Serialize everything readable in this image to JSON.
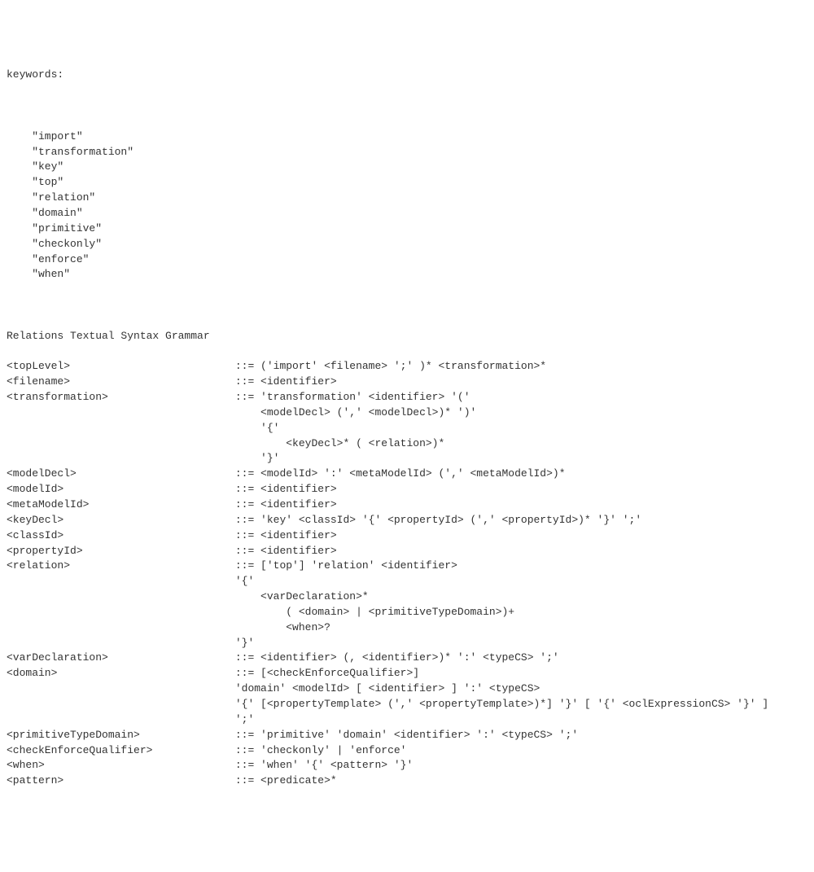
{
  "keywords_header": "keywords:",
  "keywords": [
    "\"import\"",
    "\"transformation\"",
    "\"key\"",
    "\"top\"",
    "\"relation\"",
    "\"domain\"",
    "\"primitive\"",
    "\"checkonly\"",
    "\"enforce\"",
    "\"when\""
  ],
  "grammar_header": "Relations Textual Syntax Grammar",
  "rules": [
    {
      "lhs": "<topLevel>",
      "rhs": [
        "::= ('import' <filename> ';' )* <transformation>*"
      ]
    },
    {
      "lhs": "<filename>",
      "rhs": [
        "::= <identifier>"
      ]
    },
    {
      "lhs": "<transformation>",
      "rhs": [
        "::= 'transformation' <identifier> '('",
        "    <modelDecl> (',' <modelDecl>)* ')'",
        "    '{'",
        "        <keyDecl>* ( <relation>)*",
        "    '}'"
      ]
    },
    {
      "lhs": "<modelDecl>",
      "rhs": [
        "::= <modelId> ':' <metaModelId> (',' <metaModelId>)*"
      ]
    },
    {
      "lhs": "<modelId>",
      "rhs": [
        "::= <identifier>"
      ]
    },
    {
      "lhs": "<metaModelId>",
      "rhs": [
        "::= <identifier>"
      ]
    },
    {
      "lhs": "<keyDecl>",
      "rhs": [
        "::= 'key' <classId> '{' <propertyId> (',' <propertyId>)* '}' ';'"
      ]
    },
    {
      "lhs": "<classId>",
      "rhs": [
        "::= <identifier>"
      ]
    },
    {
      "lhs": "<propertyId>",
      "rhs": [
        "::= <identifier>"
      ]
    },
    {
      "lhs": "<relation>",
      "rhs": [
        "::= ['top'] 'relation' <identifier>",
        "'{'",
        "    <varDeclaration>*",
        "        ( <domain> | <primitiveTypeDomain>)+",
        "        <when>?",
        "'}'"
      ]
    },
    {
      "lhs": "<varDeclaration>",
      "rhs": [
        "::= <identifier> (, <identifier>)* ':' <typeCS> ';'"
      ]
    },
    {
      "lhs": "<domain>",
      "rhs": [
        "::= [<checkEnforceQualifier>]",
        "'domain' <modelId> [ <identifier> ] ':' <typeCS>",
        "'{' [<propertyTemplate> (',' <propertyTemplate>)*] '}' [ '{' <oclExpressionCS> '}' ]",
        "';'"
      ]
    },
    {
      "lhs": "<primitiveTypeDomain>",
      "rhs": [
        "::= 'primitive' 'domain' <identifier> ':' <typeCS> ';'"
      ]
    },
    {
      "lhs": "<checkEnforceQualifier>",
      "rhs": [
        "::= 'checkonly' | 'enforce'"
      ]
    },
    {
      "lhs": "<when>",
      "rhs": [
        "::= 'when' '{' <pattern> '}'"
      ]
    },
    {
      "lhs": "<pattern>",
      "rhs": [
        "::= <predicate>*"
      ]
    }
  ],
  "lhs_col_width": 36
}
